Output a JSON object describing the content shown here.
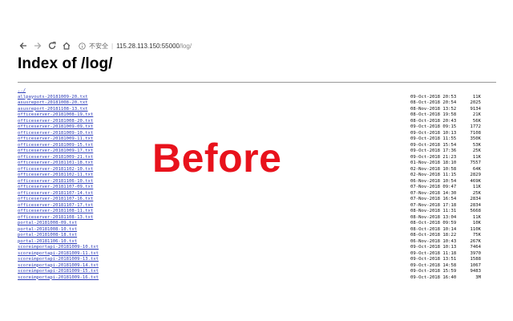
{
  "browser": {
    "security_label": "不安全",
    "url_host": "115.28.113.150:55000",
    "url_path": "/log/"
  },
  "page": {
    "heading": "Index of /log/",
    "parent_link": "../"
  },
  "files": [
    {
      "name": "allpayouts-20181009-20.txt",
      "date": "09-Oct-2018 20:53",
      "size": "11K"
    },
    {
      "name": "asusreport-20181008-20.txt",
      "date": "08-Oct-2018 20:54",
      "size": "2025"
    },
    {
      "name": "asusreport-20181108-13.txt",
      "date": "08-Nov-2018 13:52",
      "size": "9134"
    },
    {
      "name": "officeserver-20181008-19.txt",
      "date": "08-Oct-2018 19:58",
      "size": "21K"
    },
    {
      "name": "officeserver-20181008-20.txt",
      "date": "08-Oct-2018 20:43",
      "size": "56K"
    },
    {
      "name": "officeserver-20181009-09.txt",
      "date": "09-Oct-2018 09:15",
      "size": "1772"
    },
    {
      "name": "officeserver-20181009-10.txt",
      "date": "09-Oct-2018 10:13",
      "size": "7108"
    },
    {
      "name": "officeserver-20181009-11.txt",
      "date": "09-Oct-2018 11:55",
      "size": "350K"
    },
    {
      "name": "officeserver-20181009-15.txt",
      "date": "09-Oct-2018 15:54",
      "size": "53K"
    },
    {
      "name": "officeserver-20181009-17.txt",
      "date": "09-Oct-2018 17:36",
      "size": "25K"
    },
    {
      "name": "officeserver-20181009-21.txt",
      "date": "09-Oct-2018 21:23",
      "size": "11K"
    },
    {
      "name": "officeserver-20181101-18.txt",
      "date": "01-Nov-2018 18:10",
      "size": "7557"
    },
    {
      "name": "officeserver-20181102-10.txt",
      "date": "02-Nov-2018 10:58",
      "size": "64K"
    },
    {
      "name": "officeserver-20181102-11.txt",
      "date": "02-Nov-2018 11:15",
      "size": "2829"
    },
    {
      "name": "officeserver-20181106-10.txt",
      "date": "06-Nov-2018 10:54",
      "size": "469K"
    },
    {
      "name": "officeserver-20181107-09.txt",
      "date": "07-Nov-2018 09:47",
      "size": "11K"
    },
    {
      "name": "officeserver-20181107-14.txt",
      "date": "07-Nov-2018 14:30",
      "size": "25K"
    },
    {
      "name": "officeserver-20181107-16.txt",
      "date": "07-Nov-2018 16:54",
      "size": "2834"
    },
    {
      "name": "officeserver-20181107-17.txt",
      "date": "07-Nov-2018 17:18",
      "size": "2834"
    },
    {
      "name": "officeserver-20181108-11.txt",
      "date": "08-Nov-2018 11:31",
      "size": "5668"
    },
    {
      "name": "officeserver-20181108-13.txt",
      "date": "08-Nov-2018 13:04",
      "size": "11K"
    },
    {
      "name": "portal-20181008-09.txt",
      "date": "08-Oct-2018 09:59",
      "size": "10K"
    },
    {
      "name": "portal-20181008-10.txt",
      "date": "08-Oct-2018 10:14",
      "size": "110K"
    },
    {
      "name": "portal-20181008-18.txt",
      "date": "08-Oct-2018 18:22",
      "size": "75K"
    },
    {
      "name": "portal-20181106-10.txt",
      "date": "06-Nov-2018 10:43",
      "size": "267K"
    },
    {
      "name": "scoreimportapi-20181009-10.txt",
      "date": "09-Oct-2018 10:13",
      "size": "7464"
    },
    {
      "name": "scoreimportapi-20181009-11.txt",
      "date": "09-Oct-2018 11:18",
      "size": "3970"
    },
    {
      "name": "scoreimportapi-20181009-13.txt",
      "date": "09-Oct-2018 13:51",
      "size": "1588"
    },
    {
      "name": "scoreimportapi-20181009-14.txt",
      "date": "09-Oct-2018 14:58",
      "size": "1067"
    },
    {
      "name": "scoreimportapi-20181009-15.txt",
      "date": "09-Oct-2018 15:59",
      "size": "9483"
    },
    {
      "name": "scoreimportapi-20181009-16.txt",
      "date": "09-Oct-2018 16:40",
      "size": "3M"
    }
  ],
  "overlay_text": "Before",
  "colors": {
    "link": "#2b3bb8",
    "overlay": "#e8121c"
  }
}
